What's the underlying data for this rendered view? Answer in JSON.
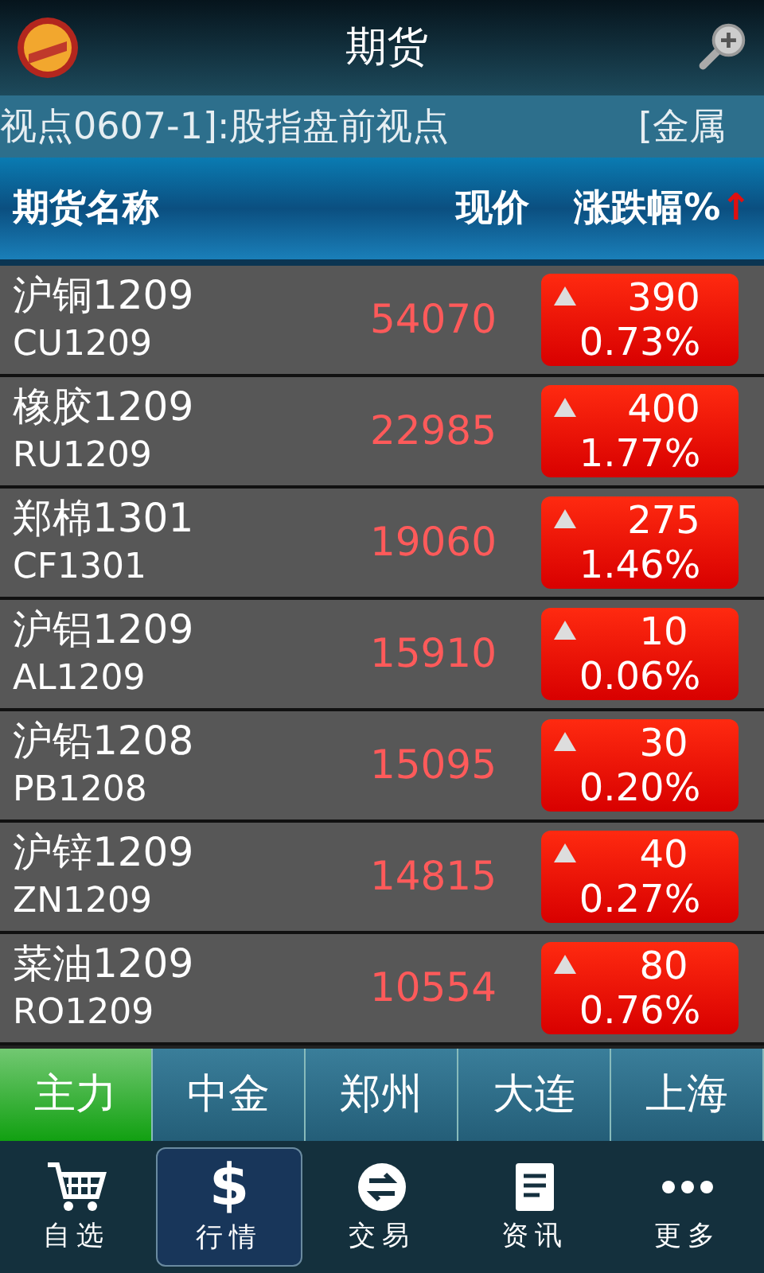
{
  "header": {
    "title": "期货"
  },
  "ticker": [
    "视点0607-1]:股指盘前视点",
    "[金属"
  ],
  "columns": [
    "期货名称",
    "现价",
    "涨跌幅%",
    "↑"
  ],
  "rows": [
    {
      "name": "沪铜1209",
      "code": "CU1209",
      "price": "54070",
      "kind": "up",
      "change": "390",
      "percent": "0.73%"
    },
    {
      "name": "橡胶1209",
      "code": "RU1209",
      "price": "22985",
      "kind": "up",
      "change": "400",
      "percent": "1.77%"
    },
    {
      "name": "郑棉1301",
      "code": "CF1301",
      "price": "19060",
      "kind": "up",
      "change": "275",
      "percent": "1.46%"
    },
    {
      "name": "沪铝1209",
      "code": "AL1209",
      "price": "15910",
      "kind": "up",
      "change": "10",
      "percent": "0.06%"
    },
    {
      "name": "沪铅1208",
      "code": "PB1208",
      "price": "15095",
      "kind": "up",
      "change": "30",
      "percent": "0.20%"
    },
    {
      "name": "沪锌1209",
      "code": "ZN1209",
      "price": "14815",
      "kind": "up",
      "change": "40",
      "percent": "0.27%"
    },
    {
      "name": "菜油1209",
      "code": "RO1209",
      "price": "10554",
      "kind": "up",
      "change": "80",
      "percent": "0.76%"
    }
  ],
  "markets": [
    {
      "label": "主力",
      "selected": true
    },
    {
      "label": "中金",
      "selected": false
    },
    {
      "label": "郑州",
      "selected": false
    },
    {
      "label": "大连",
      "selected": false
    },
    {
      "label": "上海",
      "selected": false
    }
  ],
  "nav": [
    {
      "kind": "cart",
      "label": "自选",
      "selected": false
    },
    {
      "kind": "dollar",
      "icon_text": "$",
      "label": "行情",
      "selected": true
    },
    {
      "kind": "trade",
      "label": "交易",
      "selected": false
    },
    {
      "kind": "news",
      "label": "资讯",
      "selected": false
    },
    {
      "kind": "more",
      "label": "更多",
      "selected": false
    }
  ]
}
